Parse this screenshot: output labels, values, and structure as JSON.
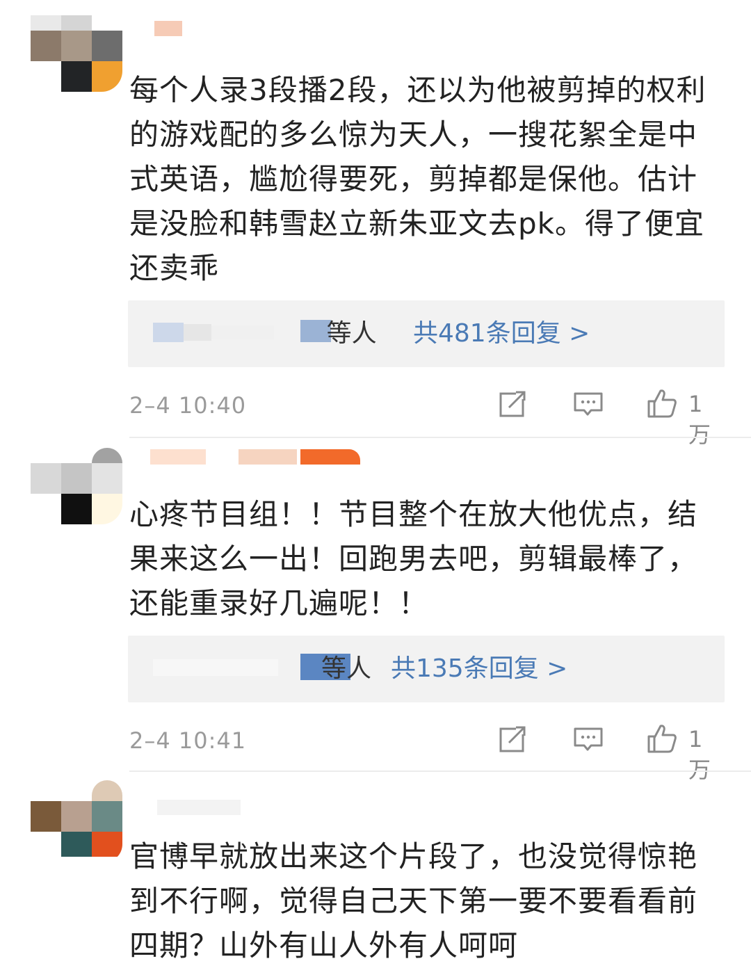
{
  "comments": [
    {
      "body": "每个人录3段播2段，还以为他被剪掉的权利\n的游戏配的多么惊为天人，一搜花絮全是中\n式英语，尴尬得要死，剪掉都是保他。估计\n是没脸和韩雪赵立新朱亚文去pk。得了便宜\n还卖乖",
      "reply_suffix": " 等人",
      "reply_link": "共481条回复 >",
      "time": "2–4 10:40",
      "likes": "1万"
    },
    {
      "body": "心疼节目组！！节目整个在放大他优点，结\n果来这么一出！回跑男去吧，剪辑最棒了，\n还能重录好几遍呢！！",
      "reply_suffix": "等人",
      "reply_link": "共135条回复 >",
      "time": "2–4 10:41",
      "likes": "1万"
    },
    {
      "body": "官博早就放出来这个片段了，也没觉得惊艳\n到不行啊，觉得自己天下第一要不要看看前\n四期？山外有山人外有人呵呵"
    }
  ],
  "icons": {
    "share": "share-icon",
    "comment": "comment-icon",
    "like": "thumbs-up-icon"
  },
  "colors": {
    "link": "#4a7ab5",
    "reply_bg": "#f2f2f2",
    "meta": "#9a9a9a"
  }
}
